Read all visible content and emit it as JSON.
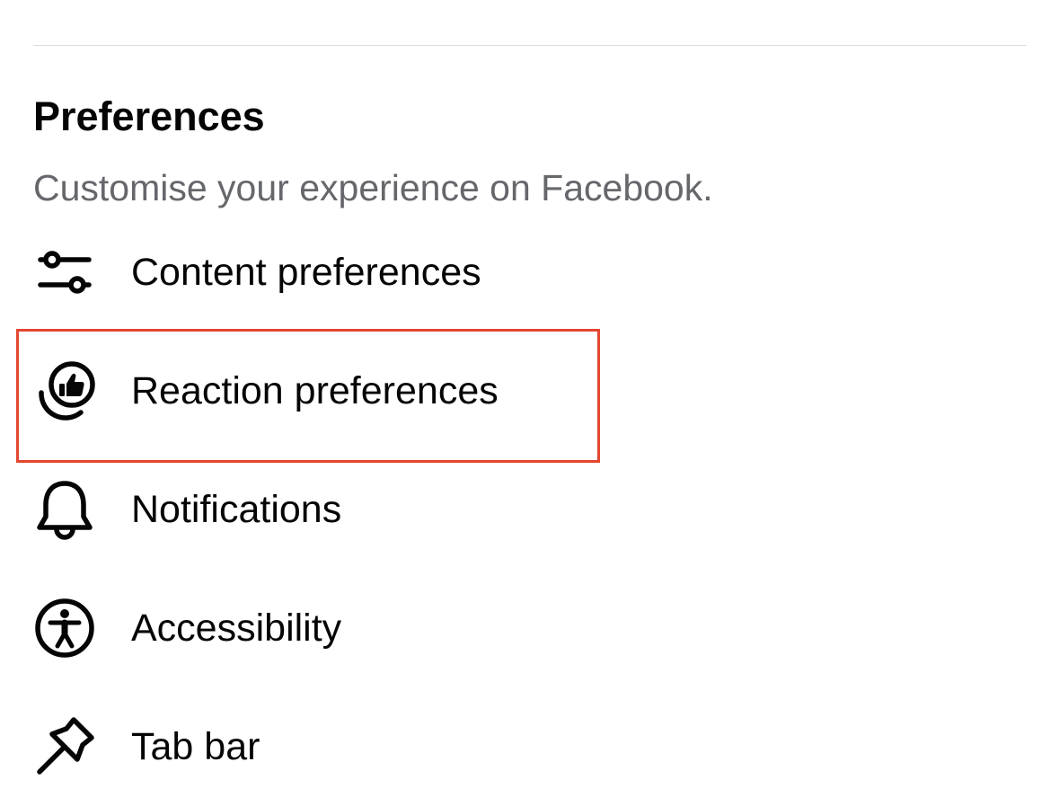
{
  "section": {
    "title": "Preferences",
    "subtitle": "Customise your experience on Facebook."
  },
  "menu": [
    {
      "label": "Content preferences",
      "icon": "sliders-icon"
    },
    {
      "label": "Reaction preferences",
      "icon": "reaction-like-icon"
    },
    {
      "label": "Notifications",
      "icon": "bell-icon"
    },
    {
      "label": "Accessibility",
      "icon": "accessibility-icon"
    },
    {
      "label": "Tab bar",
      "icon": "pin-icon"
    }
  ],
  "highlight": {
    "target": "Reaction preferences",
    "color": "#e2472f"
  },
  "colors": {
    "text_primary": "#050505",
    "text_secondary": "#65676b",
    "divider": "#dadde1"
  }
}
